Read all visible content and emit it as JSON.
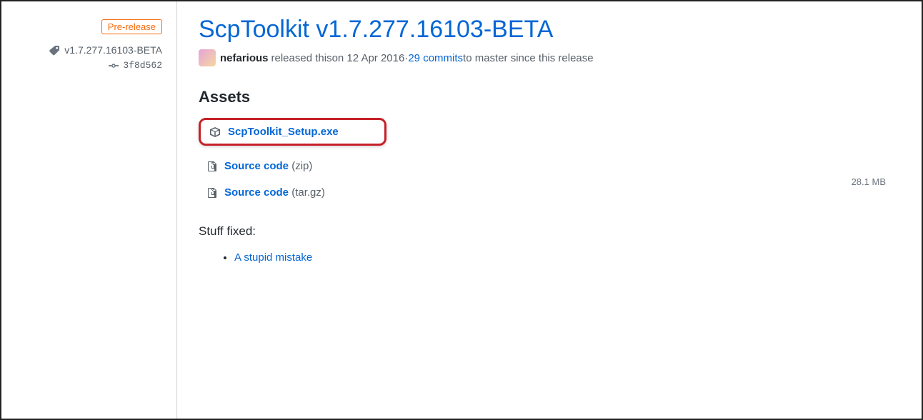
{
  "sidebar": {
    "pre_release_label": "Pre-release",
    "tag": "v1.7.277.16103-BETA",
    "commit": "3f8d562"
  },
  "release": {
    "title": "ScpToolkit v1.7.277.16103-BETA",
    "author": "nefarious",
    "released_text": " released this ",
    "date": "on 12 Apr 2016",
    "separator": " · ",
    "commits_link": "29 commits",
    "commits_trail": " to master since this release"
  },
  "assets": {
    "heading": "Assets",
    "items": [
      {
        "name": "ScpToolkit_Setup.exe",
        "ext": "",
        "size": "28.1 MB",
        "highlighted": true,
        "icon": "package-icon"
      },
      {
        "name": "Source code",
        "ext": " (zip)",
        "size": "",
        "highlighted": false,
        "icon": "zip-icon"
      },
      {
        "name": "Source code",
        "ext": " (tar.gz)",
        "size": "",
        "highlighted": false,
        "icon": "zip-icon"
      }
    ]
  },
  "notes": {
    "heading": "Stuff fixed:",
    "items": [
      {
        "text": "A stupid mistake"
      }
    ]
  }
}
